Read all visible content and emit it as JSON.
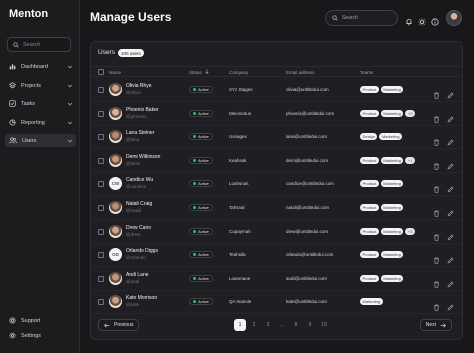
{
  "app": {
    "brand": "Menton"
  },
  "sidebar": {
    "search_placeholder": "Search",
    "items": [
      {
        "label": "Dashboard",
        "icon": "bar-chart-icon",
        "active": false
      },
      {
        "label": "Projects",
        "icon": "layers-icon",
        "active": false
      },
      {
        "label": "Tasks",
        "icon": "check-square-icon",
        "active": false
      },
      {
        "label": "Reporting",
        "icon": "pie-chart-icon",
        "active": false
      },
      {
        "label": "Users",
        "icon": "users-icon",
        "active": true
      }
    ],
    "support_label": "Support",
    "settings_label": "Settings"
  },
  "header": {
    "title": "Manage Users",
    "search_placeholder": "Search"
  },
  "users_card": {
    "title": "Users",
    "count_badge": "100 users",
    "columns": [
      "Name",
      "Status",
      "Company",
      "Email address",
      "Teams"
    ],
    "rows": [
      {
        "name": "Olivia Rhye",
        "handle": "@olivia",
        "status": "Active",
        "company": "XYz Stages",
        "email": "olivia@untitledui.com",
        "teams": [
          "Product",
          "Marketing"
        ],
        "more": "",
        "avatar": "photo"
      },
      {
        "name": "Phoenix Baker",
        "handle": "@phoenix",
        "status": "Active",
        "company": "Meionedus",
        "email": "phoenix@untitledui.com",
        "teams": [
          "Product",
          "Marketing"
        ],
        "more": "+2",
        "avatar": "photo"
      },
      {
        "name": "Lana Steiner",
        "handle": "@lana",
        "status": "Active",
        "company": "Usnagex",
        "email": "lana@untitledui.com",
        "teams": [
          "Design",
          "Marketing"
        ],
        "more": "",
        "avatar": "photo"
      },
      {
        "name": "Demi Wilkinson",
        "handle": "@demi",
        "status": "Active",
        "company": "Keahsak",
        "email": "demi@untitledui.com",
        "teams": [
          "Product",
          "Marketing"
        ],
        "more": "+1",
        "avatar": "photo"
      },
      {
        "name": "Candice Wu",
        "handle": "@candice",
        "status": "Active",
        "company": "Loahsnas",
        "email": "candice@untitledui.com",
        "teams": [
          "Product",
          "Marketing"
        ],
        "more": "",
        "avatar": "CW"
      },
      {
        "name": "Natali Craig",
        "handle": "@natali",
        "status": "Active",
        "company": "Tahsnal",
        "email": "natali@untitledui.com",
        "teams": [
          "Product",
          "Marketing"
        ],
        "more": "",
        "avatar": "photo"
      },
      {
        "name": "Drew Cano",
        "handle": "@drew",
        "status": "Active",
        "company": "Copaymah",
        "email": "drew@untitledui.com",
        "teams": [
          "Product",
          "Marketing"
        ],
        "more": "+3",
        "avatar": "photo"
      },
      {
        "name": "Orlando Diggs",
        "handle": "@orlando",
        "status": "Active",
        "company": "Teahsila",
        "email": "orlando@untitledui.com",
        "teams": [
          "Product",
          "Marketing"
        ],
        "more": "",
        "avatar": "OD"
      },
      {
        "name": "Andi Lane",
        "handle": "@andi",
        "status": "Active",
        "company": "Loanmaoe",
        "email": "andi@untitledui.com",
        "teams": [
          "Product",
          "Marketing"
        ],
        "more": "",
        "avatar": "photo"
      },
      {
        "name": "Kate Morrison",
        "handle": "@kate",
        "status": "Active",
        "company": "QA manole",
        "email": "kate@untitledui.com",
        "teams": [
          "Marketing"
        ],
        "more": "",
        "avatar": "photo"
      }
    ],
    "pagination": {
      "previous": "Previous",
      "next": "Next",
      "pages": [
        "1",
        "2",
        "3",
        "...",
        "8",
        "9",
        "10"
      ],
      "current": "1"
    }
  },
  "colors": {
    "status_active": "#22c55e",
    "background": "#18181b",
    "accent": "#f4f4f5"
  }
}
